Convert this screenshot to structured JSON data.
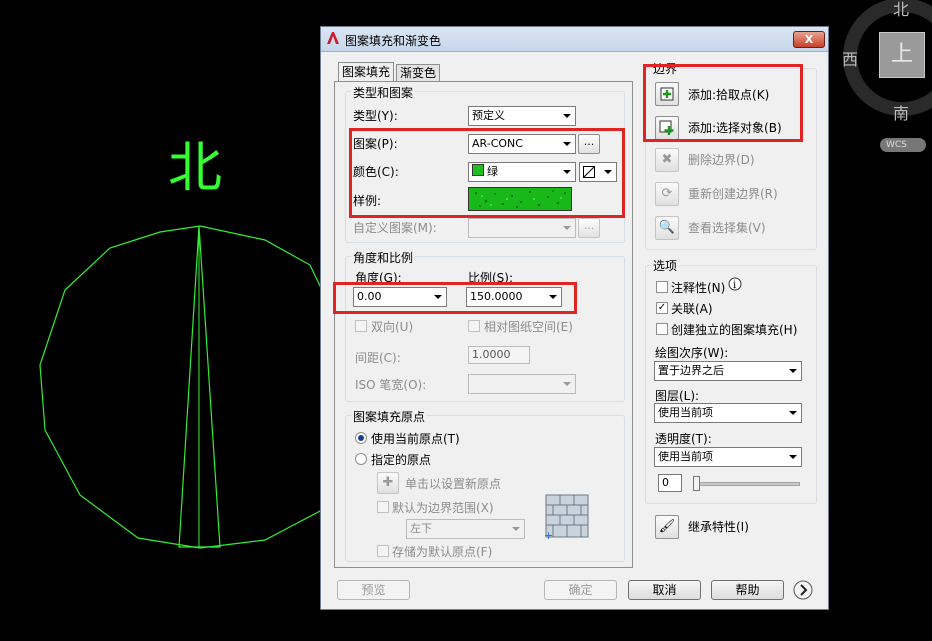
{
  "drawing": {
    "north_label": "北"
  },
  "viewcube": {
    "north": "北",
    "west": "西",
    "south": "南",
    "top": "上",
    "wcs": "WCS"
  },
  "dialog": {
    "title": "图案填充和渐变色",
    "close": "X",
    "tabs": [
      "图案填充",
      "渐变色"
    ],
    "type_group": {
      "title": "类型和图案",
      "type_label": "类型(Y):",
      "type_value": "预定义",
      "pattern_label": "图案(P):",
      "pattern_value": "AR-CONC",
      "pattern_browse": "...",
      "color_label": "颜色(C):",
      "color_value": "绿",
      "swatch_label": "样例:",
      "custom_label": "自定义图案(M):",
      "custom_browse": "..."
    },
    "angle_group": {
      "title": "角度和比例",
      "angle_label": "角度(G):",
      "angle_value": "0.00",
      "scale_label": "比例(S):",
      "scale_value": "150.0000",
      "double_label": "双向(U)",
      "relative_label": "相对图纸空间(E)",
      "spacing_label": "间距(C):",
      "spacing_value": "1.0000",
      "iso_label": "ISO 笔宽(O):"
    },
    "origin_group": {
      "title": "图案填充原点",
      "use_current": "使用当前原点(T)",
      "specified": "指定的原点",
      "click_set": "单击以设置新原点",
      "default_extent": "默认为边界范围(X)",
      "position_value": "左下",
      "store_default": "存储为默认原点(F)"
    },
    "boundary": {
      "title": "边界",
      "add_pick": "添加:拾取点(K)",
      "add_select": "添加:选择对象(B)",
      "remove": "删除边界(D)",
      "recreate": "重新创建边界(R)",
      "view_sel": "查看选择集(V)"
    },
    "options": {
      "title": "选项",
      "annotative": "注释性(N)",
      "associative": "关联(A)",
      "separate": "创建独立的图案填充(H)",
      "draw_order_label": "绘图次序(W):",
      "draw_order_value": "置于边界之后",
      "layer_label": "图层(L):",
      "layer_value": "使用当前项",
      "transparency_label": "透明度(T):",
      "transparency_value": "使用当前项",
      "transparency_num": "0",
      "inherit": "继承特性(I)"
    },
    "footer": {
      "preview": "预览",
      "ok": "确定",
      "cancel": "取消",
      "help": "帮助"
    }
  }
}
